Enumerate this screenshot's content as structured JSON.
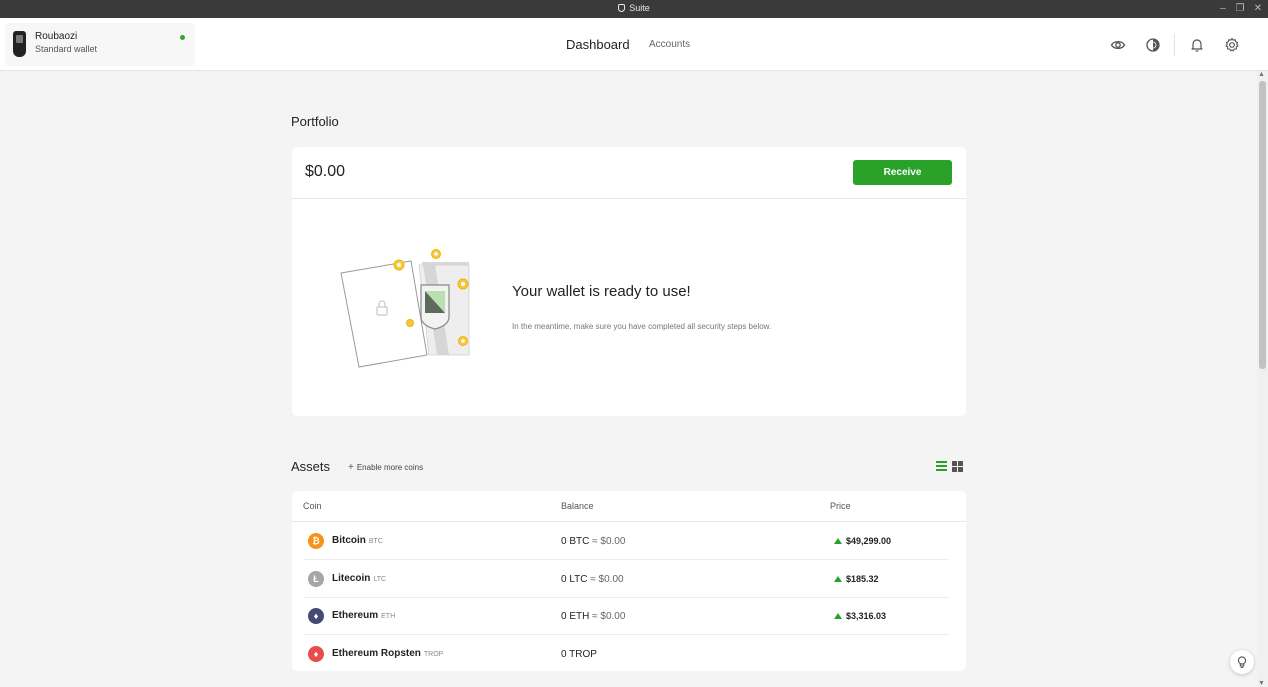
{
  "window": {
    "title": "Suite"
  },
  "device": {
    "name": "Roubaozi",
    "type": "Standard wallet"
  },
  "nav": {
    "dashboard": "Dashboard",
    "accounts": "Accounts"
  },
  "header_icons": [
    "eye-icon",
    "tor-icon",
    "bell-icon",
    "gear-icon"
  ],
  "portfolio": {
    "title": "Portfolio",
    "balance": "$0.00",
    "receive_label": "Receive",
    "ready_title": "Your wallet is ready to use!",
    "ready_subtitle": "In the meantime, make sure you have completed all security steps below."
  },
  "assets": {
    "title": "Assets",
    "enable_more": "Enable more coins",
    "columns": {
      "coin": "Coin",
      "balance": "Balance",
      "price": "Price"
    },
    "rows": [
      {
        "name": "Bitcoin",
        "symbol": "BTC",
        "balance": "0 BTC",
        "fiat": "≈ $0.00",
        "price": "$49,299.00",
        "color": "#f7931a",
        "glyph": "₿"
      },
      {
        "name": "Litecoin",
        "symbol": "LTC",
        "balance": "0 LTC",
        "fiat": "≈ $0.00",
        "price": "$185.32",
        "color": "#a6a6a6",
        "glyph": "Ł"
      },
      {
        "name": "Ethereum",
        "symbol": "ETH",
        "balance": "0 ETH",
        "fiat": "≈ $0.00",
        "price": "$3,316.03",
        "color": "#454a75",
        "glyph": "♦"
      },
      {
        "name": "Ethereum Ropsten",
        "symbol": "TROP",
        "balance": "0 TROP",
        "fiat": "",
        "price": "",
        "color": "#e84c4c",
        "glyph": "♦"
      }
    ]
  },
  "colors": {
    "accent": "#2aa22a",
    "background": "#f4f4f4",
    "titlebar": "#3a3a3a"
  }
}
